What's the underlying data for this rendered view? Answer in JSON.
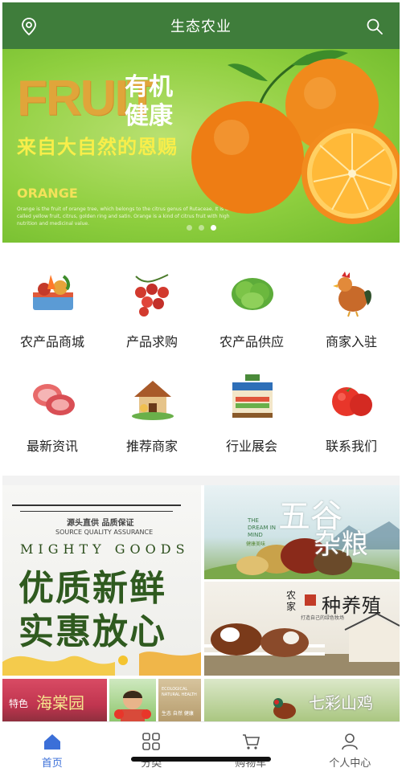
{
  "header": {
    "title": "生态农业"
  },
  "banner": {
    "headline": "FRUIT",
    "health_line1": "有机",
    "health_line2": "健康",
    "slogan": "来自大自然的恩赐",
    "orange_label": "ORANGE",
    "description": "Orange is the fruit of orange tree, which belongs to the citrus genus of Rutaceae. It is also called yellow fruit, citrus, golden ring and satin. Orange is a kind of citrus fruit with high nutrition and medicinal value.",
    "carousel": {
      "count": 3,
      "active": 3
    }
  },
  "categories": [
    {
      "label": "农产品商城",
      "icon": "vegetable-basket-icon"
    },
    {
      "label": "产品求购",
      "icon": "cherries-icon"
    },
    {
      "label": "农产品供应",
      "icon": "lettuce-icon"
    },
    {
      "label": "商家入驻",
      "icon": "rooster-icon"
    },
    {
      "label": "最新资讯",
      "icon": "meat-icon"
    },
    {
      "label": "推荐商家",
      "icon": "farmhouse-icon"
    },
    {
      "label": "行业展会",
      "icon": "farm-stall-icon"
    },
    {
      "label": "联系我们",
      "icon": "tomato-icon"
    }
  ],
  "promo": {
    "big": {
      "source_cn": "源头直供 品质保证",
      "source_en": "SOURCE QUALITY ASSURANCE",
      "mighty": "MIGHTY GOODS",
      "line1": "优质新鲜",
      "line2": "实惠放心"
    },
    "grain": {
      "title1": "五谷",
      "title2": "杂粮",
      "dream": "THE DREAM IN MIND",
      "caption": "健康美味"
    },
    "breeding": {
      "farmer": "农家",
      "title": "种养殖",
      "caption": "打造自己的绿色牧场"
    },
    "haitang": {
      "tag": "特色",
      "title": "海棠园"
    },
    "ecological": {
      "en": "ECOLOGICAL NATURAL HEALTH",
      "cn": "生态 自然 健康"
    },
    "pheasant": {
      "title": "七彩山鸡"
    }
  },
  "tabbar": [
    {
      "label": "首页",
      "icon": "home-icon",
      "active": true
    },
    {
      "label": "分类",
      "icon": "grid-icon",
      "active": false
    },
    {
      "label": "购物车",
      "icon": "cart-icon",
      "active": false
    },
    {
      "label": "个人中心",
      "icon": "user-icon",
      "active": false
    }
  ],
  "colors": {
    "header": "#3f7d3b",
    "active_tab": "#3b6fd8"
  }
}
